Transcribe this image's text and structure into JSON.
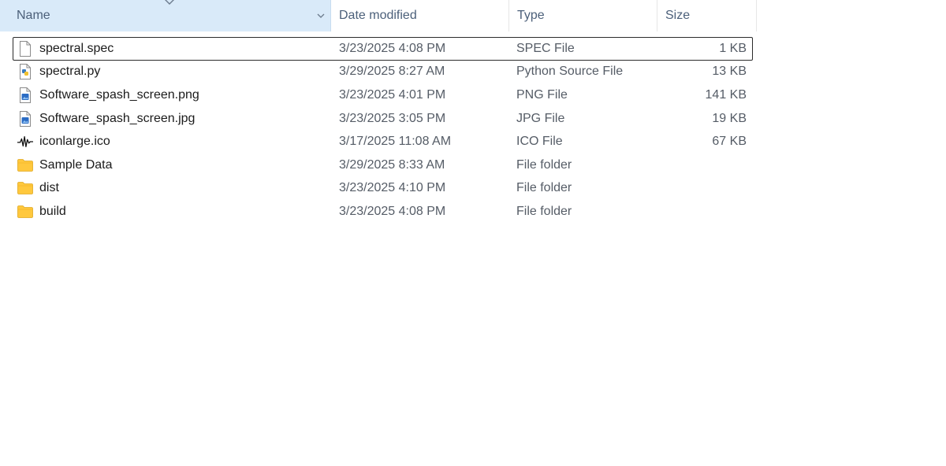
{
  "columns": {
    "name": "Name",
    "date_modified": "Date modified",
    "type": "Type",
    "size": "Size"
  },
  "files": [
    {
      "name": "spectral.spec",
      "date": "3/23/2025 4:08 PM",
      "type": "SPEC File",
      "size": "1 KB",
      "icon": "blank-file-icon"
    },
    {
      "name": "spectral.py",
      "date": "3/29/2025 8:27 AM",
      "type": "Python Source File",
      "size": "13 KB",
      "icon": "python-file-icon"
    },
    {
      "name": "Software_spash_screen.png",
      "date": "3/23/2025 4:01 PM",
      "type": "PNG File",
      "size": "141 KB",
      "icon": "image-file-icon"
    },
    {
      "name": "Software_spash_screen.jpg",
      "date": "3/23/2025 3:05 PM",
      "type": "JPG File",
      "size": "19 KB",
      "icon": "image-file-icon"
    },
    {
      "name": "iconlarge.ico",
      "date": "3/17/2025 11:08 AM",
      "type": "ICO File",
      "size": "67 KB",
      "icon": "waveform-icon"
    },
    {
      "name": "Sample Data",
      "date": "3/29/2025 8:33 AM",
      "type": "File folder",
      "size": "",
      "icon": "folder-icon"
    },
    {
      "name": "dist",
      "date": "3/23/2025 4:10 PM",
      "type": "File folder",
      "size": "",
      "icon": "folder-icon"
    },
    {
      "name": "build",
      "date": "3/23/2025 4:08 PM",
      "type": "File folder",
      "size": "",
      "icon": "folder-icon"
    }
  ],
  "colors": {
    "header_selected_bg": "#d9eaf9",
    "header_text": "#4c607a",
    "folder_yellow": "#ffc83d",
    "python_blue": "#3b7bbf"
  }
}
